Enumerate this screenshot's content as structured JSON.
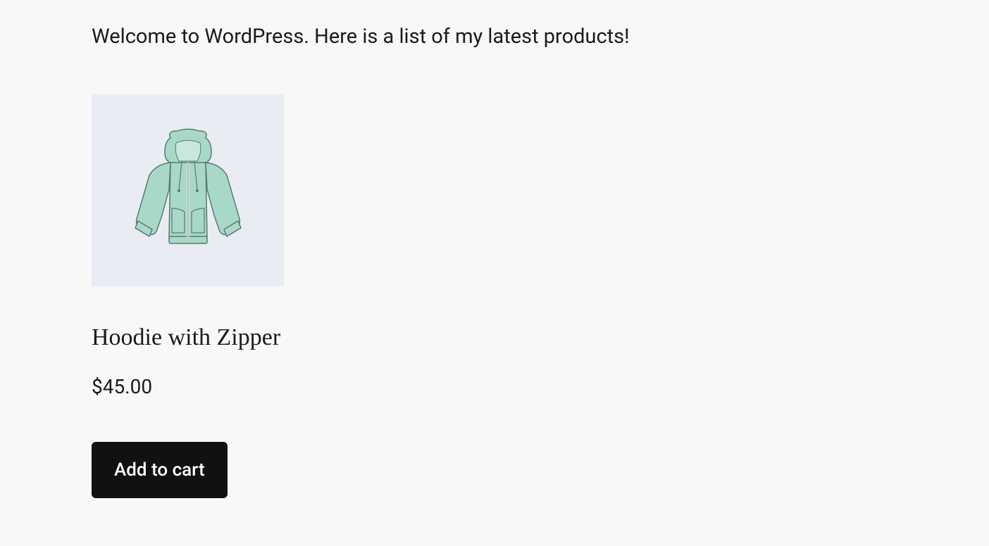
{
  "intro": {
    "text": "Welcome to WordPress. Here is a list of my latest products!"
  },
  "products": [
    {
      "title": "Hoodie with Zipper",
      "price": "$45.00",
      "add_to_cart_label": "Add to cart",
      "image_alt": "hoodie-with-zipper",
      "image_bg": "#e9edf3",
      "hoodie_fill": "#a8d8c8",
      "hoodie_stroke": "#5a7a6f"
    }
  ]
}
